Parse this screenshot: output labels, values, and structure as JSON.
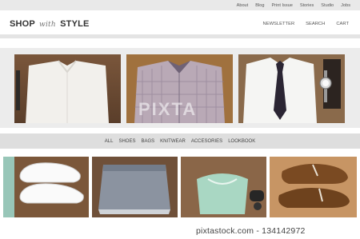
{
  "topnav": {
    "items": [
      "About",
      "Blog",
      "Print Issue",
      "Stories",
      "Studio",
      "Jobs"
    ]
  },
  "logo": {
    "part1": "SHOP",
    "part2": "with",
    "part3": "STYLE"
  },
  "mainnav": {
    "items": [
      "NEWSLETTER",
      "SEARCH",
      "CART"
    ]
  },
  "categories": {
    "items": [
      "ALL",
      "SHOES",
      "BAGS",
      "KNITWEAR",
      "ACCESORIES",
      "LOOKBOOK"
    ]
  },
  "watermark": {
    "center": "PIXTA",
    "text": "pixtastock.com - 134142972"
  }
}
